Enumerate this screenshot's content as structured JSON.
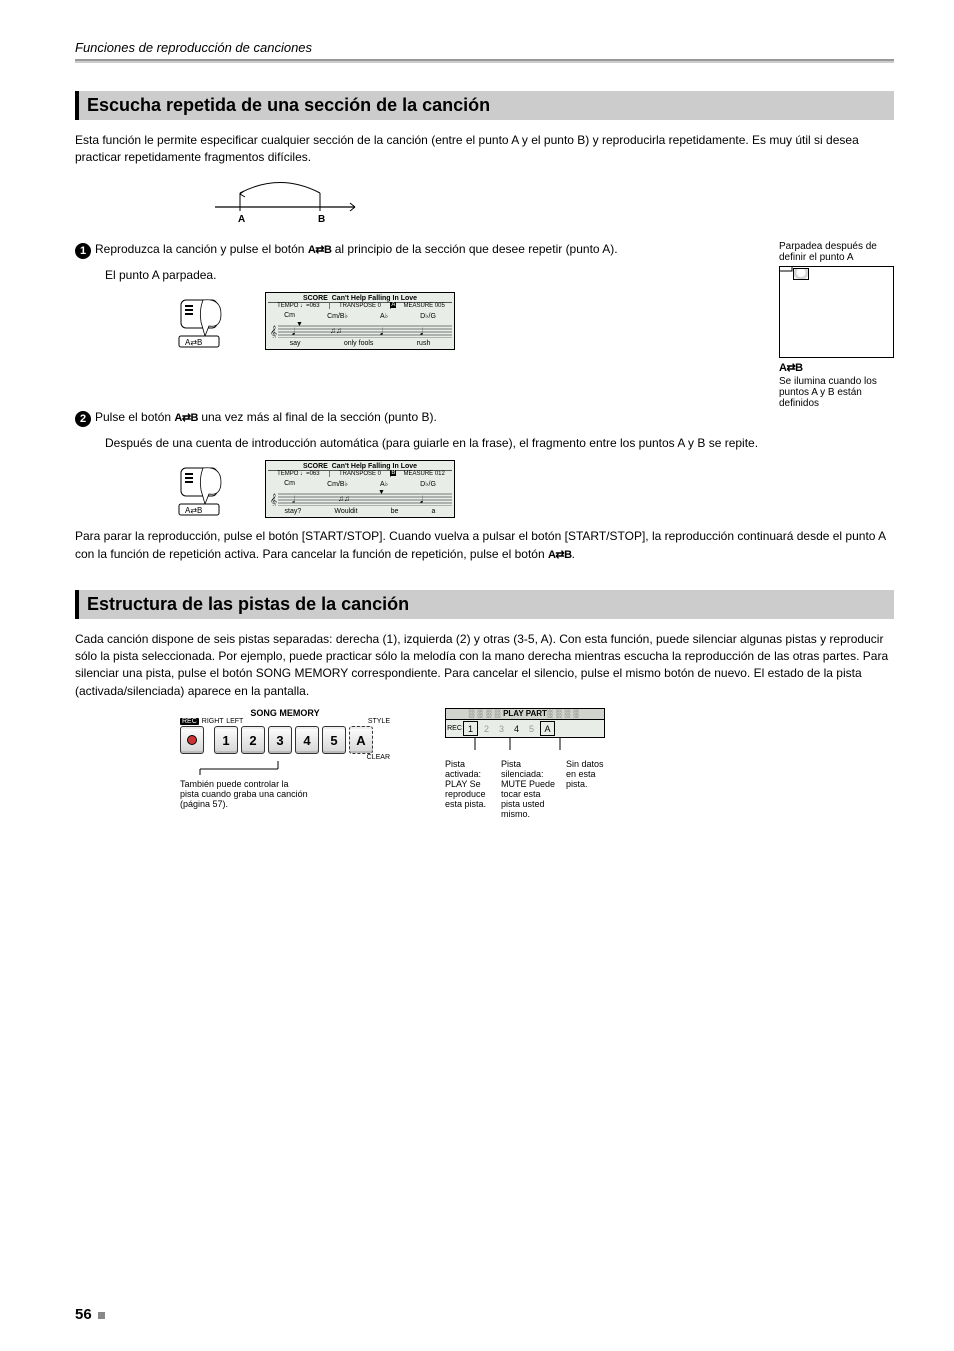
{
  "breadcrumb": "Funciones de reproducción de canciones",
  "sections": {
    "repeat": {
      "title": "Escucha repetida de una sección de la canción",
      "intro": "Esta función le permite especificar cualquier sección de la canción (entre el punto A y el punto B) y reproducirla repetidamente. Es muy útil si desea practicar repetidamente fragmentos difíciles.",
      "diagram_labels": {
        "a": "A",
        "b": "B"
      },
      "step1": {
        "num": "1",
        "text_start": "Reproduzca la canción y pulse el botón ",
        "btn": "A    B",
        "text_end": " al principio de la sección que desee repetir (punto A).",
        "under": "El punto A parpadea."
      },
      "screen1": {
        "title_label": "SCORE",
        "title_song": "Can't Help Falling In Love",
        "tempo": "TEMPO ♩=063",
        "transpose": "TRANSPOSE   0",
        "measure": "MEASURE 005",
        "chords": [
          "Cm",
          "Cm/B♭",
          "A♭",
          "D♭/G"
        ],
        "lyrics": [
          "say",
          "only fools",
          "rush"
        ],
        "marker": "A",
        "ab_label1": "Parpadea después de definir el punto A",
        "ab_label2": "Se ilumina cuando los puntos A y B están definidos"
      },
      "step2": {
        "num": "2",
        "text_start": "Pulse el botón ",
        "btn": "A    B",
        "text_end": " una vez más al final de la sección (punto B).",
        "under": "Después de una cuenta de introducción automática (para guiarle en la frase), el fragmento entre los puntos A y B se repite."
      },
      "screen2": {
        "title_label": "SCORE",
        "title_song": "Can't Help Falling In Love",
        "tempo": "TEMPO ♩=063",
        "transpose": "TRANSPOSE   0",
        "measure": "MEASURE 012",
        "chords": [
          "Cm",
          "Cm/B♭",
          "A♭",
          "D♭/G"
        ],
        "lyrics": [
          "stay?",
          "Wouldit",
          "be",
          "a"
        ],
        "marker": "B"
      },
      "stop": {
        "text_start": "Para parar la reproducción, pulse el botón [START/STOP]. Cuando vuelva a pulsar el botón [START/STOP], la reproducción continuará desde el punto A con la función de repetición activa. Para cancelar la función de repetición, pulse el botón ",
        "btn": "A    B",
        "text_end": "."
      }
    },
    "tracks": {
      "title": "Estructura de las pistas de la canción",
      "intro": "Cada canción dispone de seis pistas separadas: derecha (1), izquierda (2) y otras (3-5, A). Con esta función, puede silenciar algunas pistas y reproducir sólo la pista seleccionada. Por ejemplo, puede practicar sólo la melodía con la mano derecha mientras escucha la reproducción de las otras partes. Para silenciar una pista, pulse el botón SONG MEMORY correspondiente. Para cancelar el silencio, pulse el mismo botón de nuevo. El estado de la pista (activada/silenciada) aparece en la pantalla.",
      "panel": {
        "header": "SONG MEMORY",
        "labels": {
          "rec": "REC",
          "right": "RIGHT",
          "left": "LEFT",
          "style": "STYLE",
          "clear": "CLEAR"
        },
        "keys": [
          "●",
          "1",
          "2",
          "3",
          "4",
          "5",
          "A"
        ],
        "note": "También puede controlar la pista cuando graba una canción (página 57)."
      },
      "play_part": {
        "bar": "PLAY PART",
        "rec": "REC",
        "slots": [
          "1",
          "2",
          "3",
          "4",
          "5",
          "A"
        ],
        "cap1": "Pista activada: PLAY Se reproduce esta pista.",
        "cap2": "Pista silenciada: MUTE Puede tocar esta pista usted mismo.",
        "cap3": "Sin datos en esta pista."
      }
    }
  },
  "ab_symbol": "A⇄B",
  "footer": {
    "page": "56"
  }
}
